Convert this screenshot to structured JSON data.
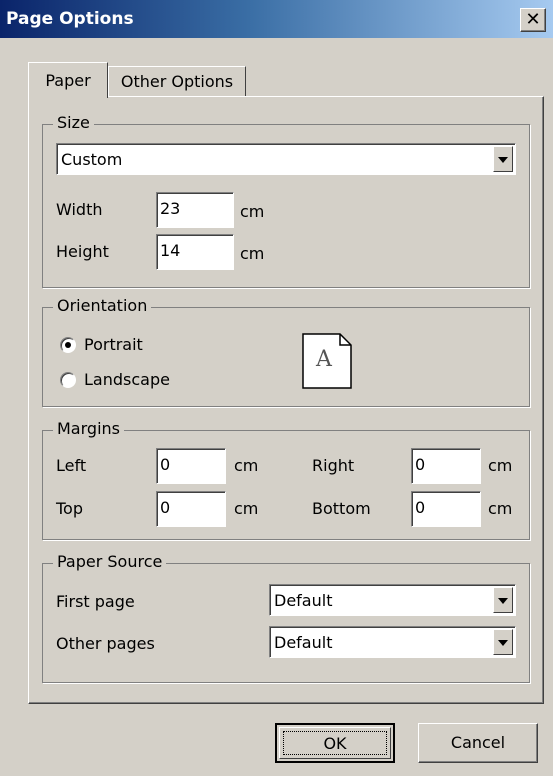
{
  "window": {
    "title": "Page Options",
    "close_glyph": "✕"
  },
  "tabs": [
    {
      "label": "Paper",
      "active": true
    },
    {
      "label": "Other Options",
      "active": false
    }
  ],
  "size": {
    "legend": "Size",
    "paper_size": "Custom",
    "width_label": "Width",
    "width_value": "23",
    "width_unit": "cm",
    "height_label": "Height",
    "height_value": "14",
    "height_unit": "cm"
  },
  "orientation": {
    "legend": "Orientation",
    "portrait_label": "Portrait",
    "landscape_label": "Landscape",
    "selected": "Portrait",
    "preview_letter": "A"
  },
  "margins": {
    "legend": "Margins",
    "left_label": "Left",
    "left_value": "0",
    "left_unit": "cm",
    "right_label": "Right",
    "right_value": "0",
    "right_unit": "cm",
    "top_label": "Top",
    "top_value": "0",
    "top_unit": "cm",
    "bottom_label": "Bottom",
    "bottom_value": "0",
    "bottom_unit": "cm"
  },
  "paper_source": {
    "legend": "Paper Source",
    "first_page_label": "First page",
    "first_page_value": "Default",
    "other_pages_label": "Other pages",
    "other_pages_value": "Default"
  },
  "buttons": {
    "ok": "OK",
    "cancel": "Cancel"
  },
  "colors": {
    "dialog_bg": "#d4d0c8",
    "titlebar_start": "#0a246a",
    "titlebar_end": "#a6caf0",
    "title_text": "#ffffff"
  }
}
